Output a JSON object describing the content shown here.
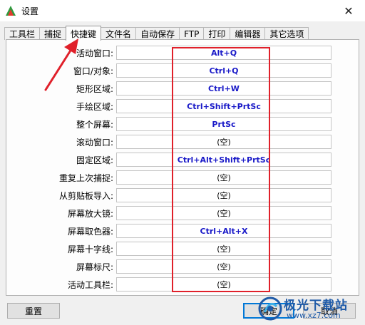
{
  "window": {
    "title": "设置",
    "close_glyph": "✕"
  },
  "tabs": [
    {
      "label": "工具栏",
      "active": false
    },
    {
      "label": "捕捉",
      "active": false
    },
    {
      "label": "快捷键",
      "active": true
    },
    {
      "label": "文件名",
      "active": false
    },
    {
      "label": "自动保存",
      "active": false
    },
    {
      "label": "FTP",
      "active": false
    },
    {
      "label": "打印",
      "active": false
    },
    {
      "label": "编辑器",
      "active": false
    },
    {
      "label": "其它选项",
      "active": false
    }
  ],
  "hotkeys": [
    {
      "label": "活动窗口:",
      "value": "Alt+Q",
      "set": true
    },
    {
      "label": "窗口/对象:",
      "value": "Ctrl+Q",
      "set": true
    },
    {
      "label": "矩形区域:",
      "value": "Ctrl+W",
      "set": true
    },
    {
      "label": "手绘区域:",
      "value": "Ctrl+Shift+PrtSc",
      "set": true
    },
    {
      "label": "整个屏幕:",
      "value": "PrtSc",
      "set": true
    },
    {
      "label": "滚动窗口:",
      "value": "(空)",
      "set": false
    },
    {
      "label": "固定区域:",
      "value": "Ctrl+Alt+Shift+PrtSc",
      "set": true
    },
    {
      "label": "重复上次捕捉:",
      "value": "(空)",
      "set": false
    },
    {
      "label": "从剪贴板导入:",
      "value": "(空)",
      "set": false
    },
    {
      "label": "屏幕放大镜:",
      "value": "(空)",
      "set": false
    },
    {
      "label": "屏幕取色器:",
      "value": "Ctrl+Alt+X",
      "set": true
    },
    {
      "label": "屏幕十字线:",
      "value": "(空)",
      "set": false
    },
    {
      "label": "屏幕标尺:",
      "value": "(空)",
      "set": false
    },
    {
      "label": "活动工具栏:",
      "value": "(空)",
      "set": false
    }
  ],
  "buttons": {
    "reset": "重置",
    "ok": "确定",
    "cancel": "取消"
  },
  "watermark": {
    "title": "极光下载站",
    "url": "www.xz7.com"
  },
  "colors": {
    "hotkey_text": "#1a1ac8",
    "annotation_red": "#e0202a",
    "focus_blue": "#0078d7"
  }
}
